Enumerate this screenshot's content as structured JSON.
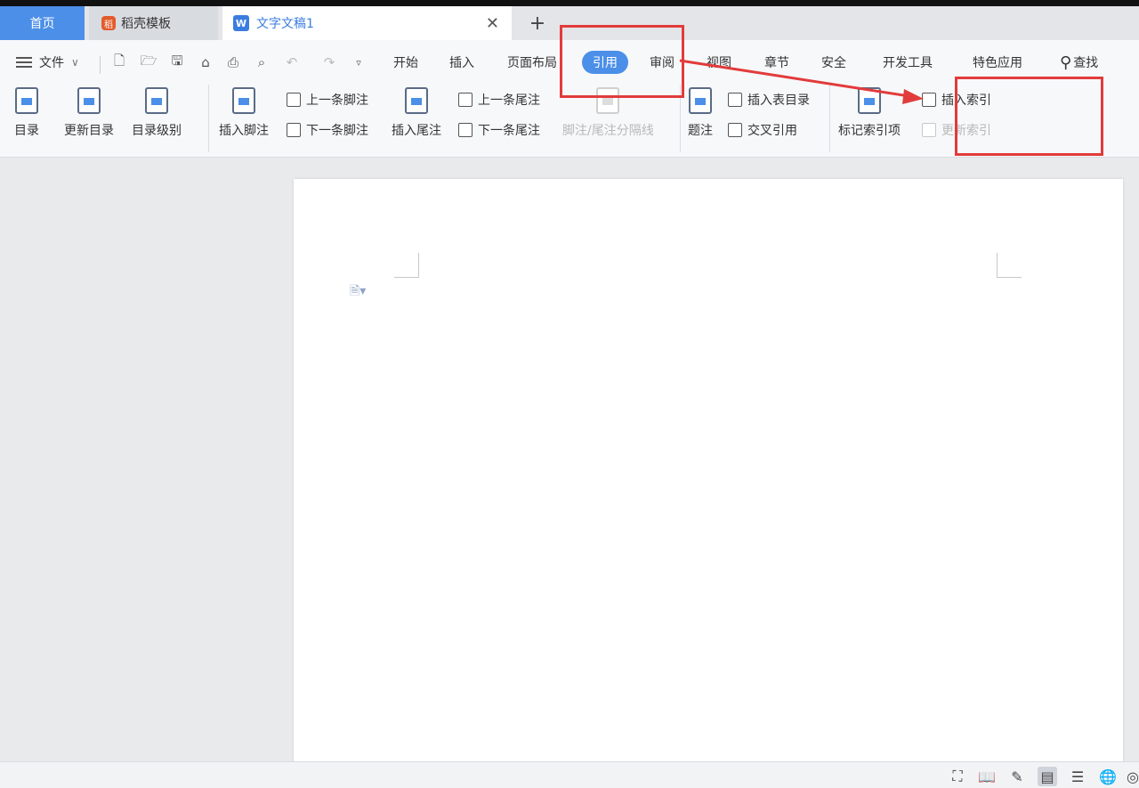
{
  "tabs": {
    "home": "首页",
    "daoke": "稻壳模板",
    "doc": "文字文稿1",
    "daoke_icon": "稻",
    "doc_icon": "W",
    "close": "✕",
    "add": "+"
  },
  "menu": {
    "file": "文件",
    "file_arrow": "∨",
    "items": [
      "开始",
      "插入",
      "页面布局",
      "引用",
      "审阅",
      "视图",
      "章节",
      "安全",
      "开发工具",
      "特色应用"
    ],
    "active": "引用",
    "search": "查找",
    "quick_access_icons": [
      "new-icon",
      "open-icon",
      "save-icon",
      "format-painter-icon",
      "print-icon",
      "print-preview-icon",
      "undo-icon",
      "redo-icon",
      "customize-icon"
    ]
  },
  "ribbon": {
    "toc": "目录",
    "update_toc": "更新目录",
    "toc_level": "目录级别",
    "insert_footnote": "插入脚注",
    "prev_footnote": "上一条脚注",
    "next_footnote": "下一条脚注",
    "insert_endnote": "插入尾注",
    "prev_endnote": "上一条尾注",
    "next_endnote": "下一条尾注",
    "separator": "脚注/尾注分隔线",
    "caption": "题注",
    "insert_toc_table": "插入表目录",
    "cross_ref": "交叉引用",
    "mark_index": "标记索引项",
    "insert_index": "插入索引",
    "update_index": "更新索引"
  },
  "colors": {
    "accent": "#4b8fe8",
    "highlight": "#e23b3b"
  },
  "statusbar": {
    "icons": [
      "fullscreen-icon",
      "reading-mode-icon",
      "edit-mode-icon",
      "page-view-icon",
      "outline-view-icon",
      "web-view-icon",
      "eye-protection-icon"
    ]
  }
}
